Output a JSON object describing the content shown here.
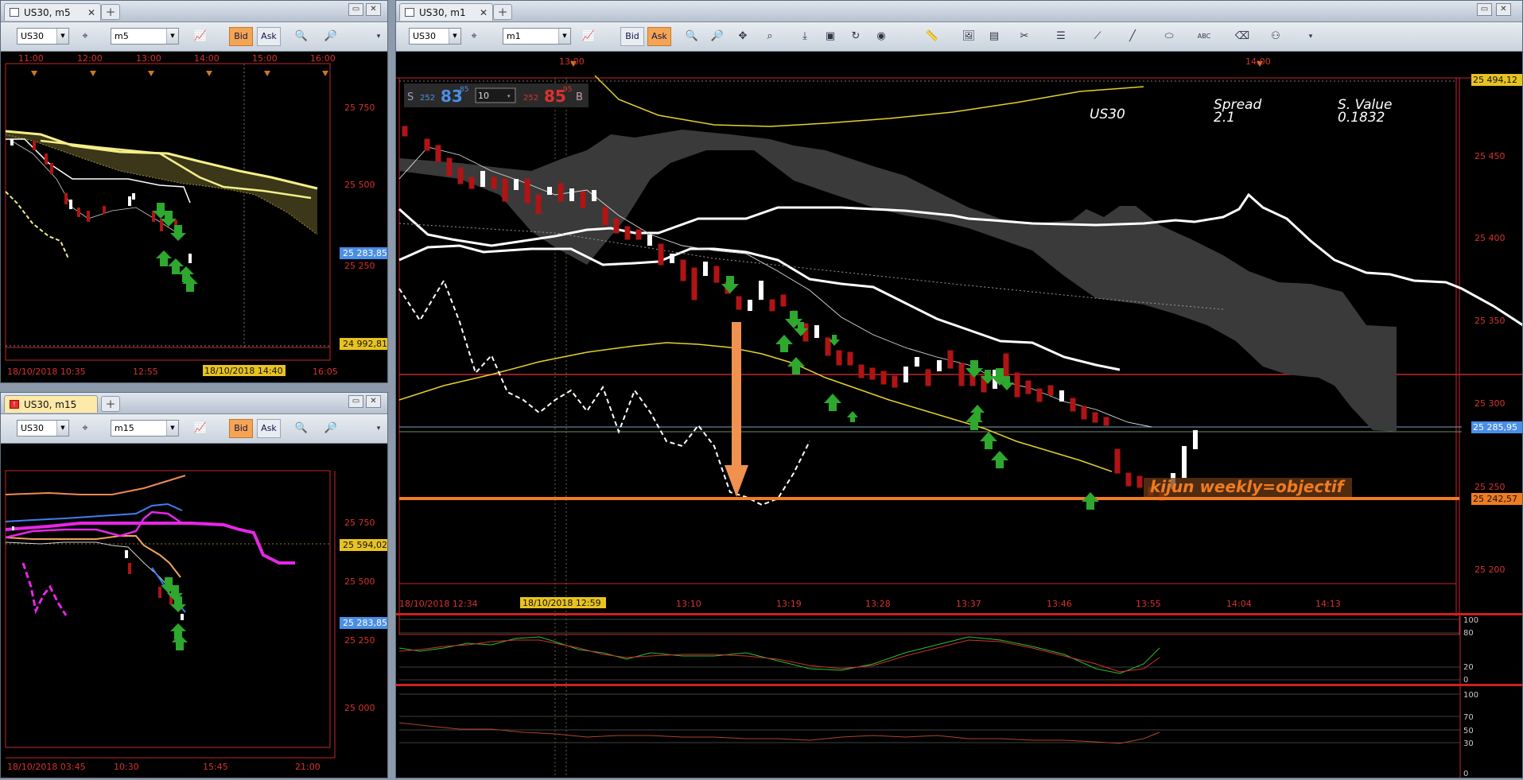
{
  "windows": {
    "m5": {
      "tab_label": "US30, m5",
      "symbol": "US30",
      "timeframe": "m5",
      "bid_label": "Bid",
      "ask_label": "Ask",
      "time_labels_top": [
        "11:00",
        "12:00",
        "13:00",
        "14:00",
        "15:00",
        "16:00"
      ],
      "price_labels": [
        "25 750",
        "25 500",
        "25 250"
      ],
      "price_badge_blue": "25 283,85",
      "price_badge_yellow": "24 992,81",
      "time_labels_bottom": [
        "18/10/2018 10:35",
        "12:55",
        "16:05"
      ],
      "cursor_time": "18/10/2018 14:40"
    },
    "m15": {
      "tab_label": "US30, m15",
      "symbol": "US30",
      "timeframe": "m15",
      "bid_label": "Bid",
      "ask_label": "Ask",
      "price_labels": [
        "25 750",
        "25 500",
        "25 250",
        "25 000"
      ],
      "price_badge_yellow": "25 594,02",
      "price_badge_blue": "25 283,85",
      "time_labels_bottom": [
        "18/10/2018 03:45",
        "10:30",
        "15:45",
        "21:00"
      ]
    },
    "m1": {
      "tab_label": "US30, m1",
      "symbol": "US30",
      "timeframe": "m1",
      "bid_label": "Bid",
      "ask_label": "Ask",
      "time_labels_top": [
        "13:00",
        "14:00"
      ],
      "price_labels": [
        "25 450",
        "25 400",
        "25 350",
        "25 300",
        "25 250",
        "25 200"
      ],
      "price_badge_top": "25 494,12",
      "price_badge_blue": "25 285,95",
      "price_badge_orange": "25 242,57",
      "time_labels_bottom": [
        "18/10/2018 12:34",
        "13:10",
        "13:19",
        "13:28",
        "13:37",
        "13:46",
        "13:55",
        "14:04",
        "14:13"
      ],
      "cursor_time": "18/10/2018 12:59",
      "trade_panel": {
        "sell_label": "S",
        "sell_qty": "252",
        "sell_price": "83",
        "sell_pips": "85",
        "lot": "10",
        "buy_qty": "252",
        "buy_price": "85",
        "buy_pips": "95",
        "buy_label": "B"
      },
      "info": {
        "symbol": "US30",
        "spread_label": "Spread",
        "spread_value": "2.1",
        "svalue_label": "S. Value",
        "svalue_value": "0.1832"
      },
      "annotation": "kijun weekly=objectif",
      "stoch_levels": [
        "100",
        "80",
        "20",
        "0"
      ],
      "rsi_levels": [
        "100",
        "70",
        "50",
        "30",
        "0"
      ]
    }
  },
  "colors": {
    "bid_active": "#f4a553",
    "sell_blue": "#4a8fe7",
    "buy_red": "#e03030",
    "grid_red": "#c0282c",
    "annotation_orange": "#f07c20",
    "kijun_white": "#ffffff",
    "cloud_gray": "#3a3a3a",
    "ma_yellow": "#e6d12a"
  }
}
